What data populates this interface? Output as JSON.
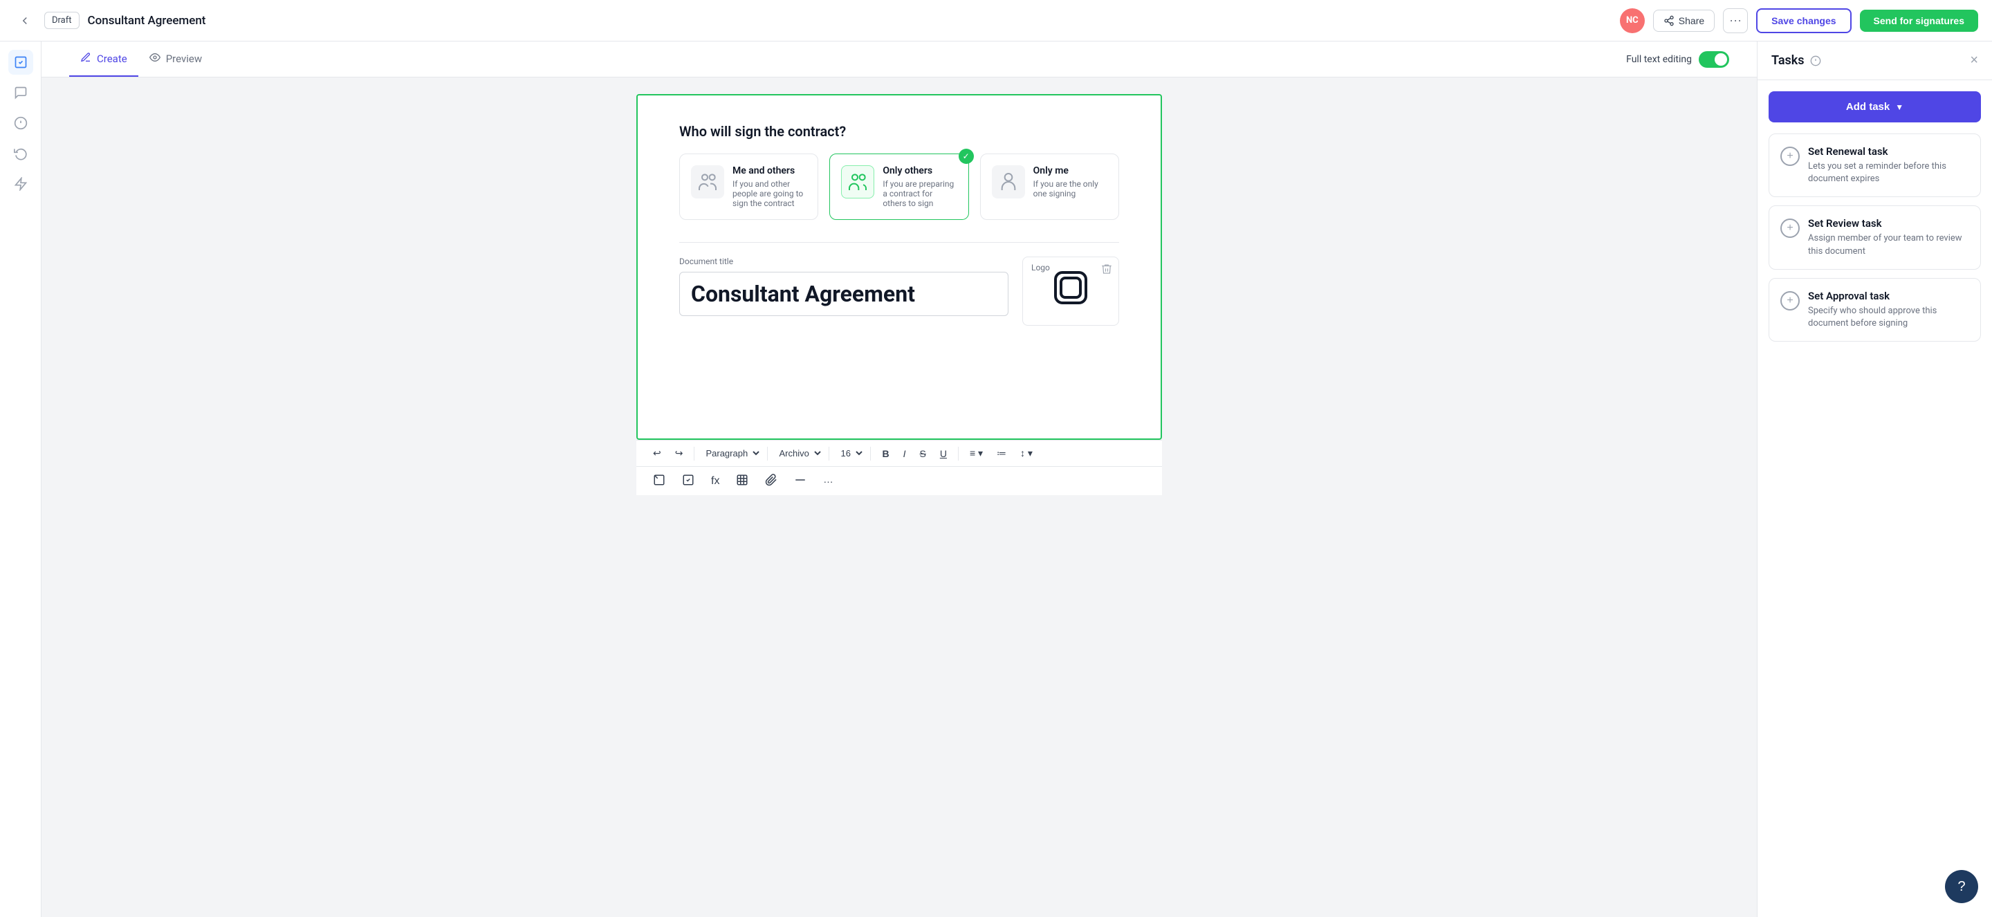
{
  "header": {
    "back_label": "←",
    "draft_label": "Draft",
    "doc_title": "Consultant Agreement",
    "avatar_initials": "NC",
    "share_label": "Share",
    "save_label": "Save changes",
    "send_label": "Send for signatures"
  },
  "tabs": {
    "create_label": "Create",
    "preview_label": "Preview",
    "full_text_label": "Full text editing"
  },
  "signing": {
    "question": "Who will sign the contract?",
    "options": [
      {
        "title": "Me and others",
        "description": "If you and other people are going to sign the contract",
        "selected": false
      },
      {
        "title": "Only others",
        "description": "If you are preparing a contract for others to sign",
        "selected": true
      },
      {
        "title": "Only me",
        "description": "If you are the only one signing",
        "selected": false
      }
    ]
  },
  "document": {
    "title_label": "Document title",
    "title_value": "Consultant Agreement",
    "logo_label": "Logo"
  },
  "toolbar": {
    "paragraph_label": "Paragraph",
    "font_label": "Archivo",
    "size_label": "16"
  },
  "tasks_panel": {
    "title": "Tasks",
    "close_label": "×",
    "add_task_label": "Add task",
    "tasks": [
      {
        "title": "Set Renewal task",
        "description": "Lets you set a reminder before this document expires"
      },
      {
        "title": "Set Review task",
        "description": "Assign member of your team to review this document"
      },
      {
        "title": "Set Approval task",
        "description": "Specify who should approve this document before signing"
      }
    ]
  },
  "help": {
    "label": "?"
  }
}
